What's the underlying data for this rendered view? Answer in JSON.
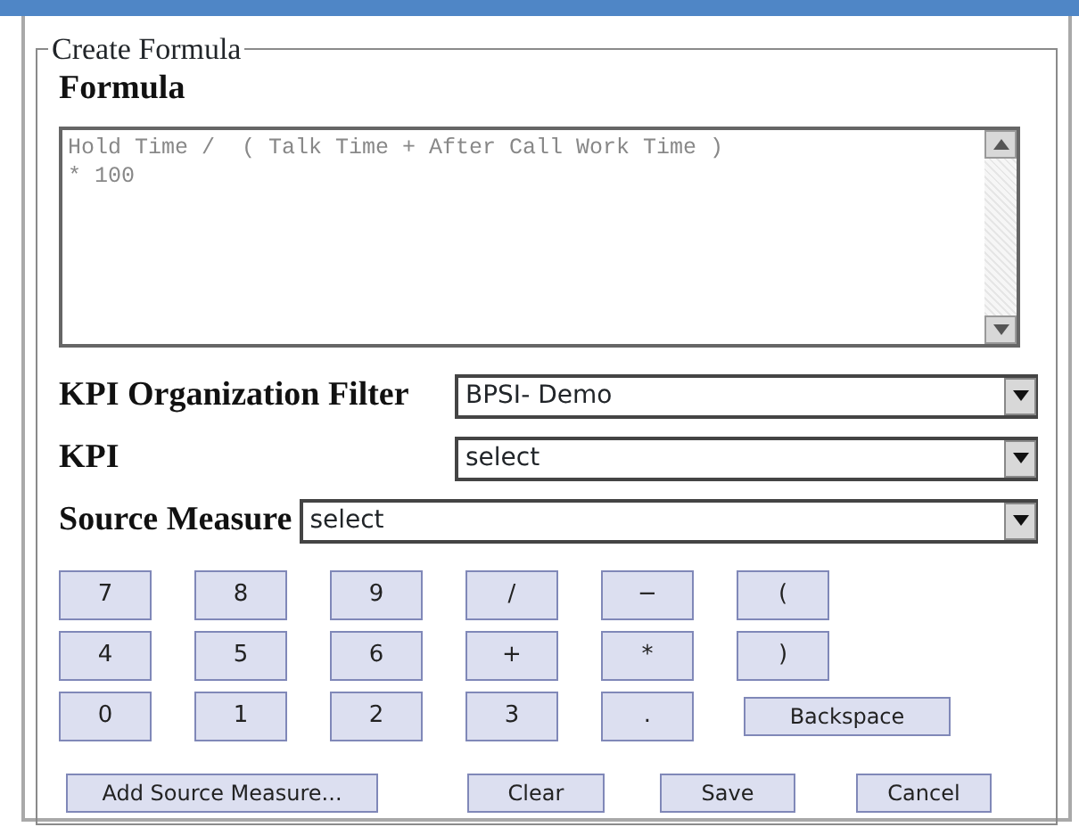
{
  "panel": {
    "legend": "Create Formula"
  },
  "formula": {
    "label": "Formula",
    "value": "Hold Time /  ( Talk Time + After Call Work Time )\n* 100"
  },
  "filters": [
    {
      "label": "KPI Organization Filter",
      "value": "BPSI- Demo"
    },
    {
      "label": "KPI",
      "value": "select"
    },
    {
      "label": "Source Measure",
      "value": "select"
    }
  ],
  "keypad": [
    [
      "7",
      "8",
      "9",
      "/",
      "−",
      "("
    ],
    [
      "4",
      "5",
      "6",
      "+",
      "*",
      ")"
    ],
    [
      "0",
      "1",
      "2",
      "3",
      ".",
      "Backspace"
    ]
  ],
  "buttons": [
    "Add Source Measure...",
    "Clear",
    "Save",
    "Cancel"
  ]
}
